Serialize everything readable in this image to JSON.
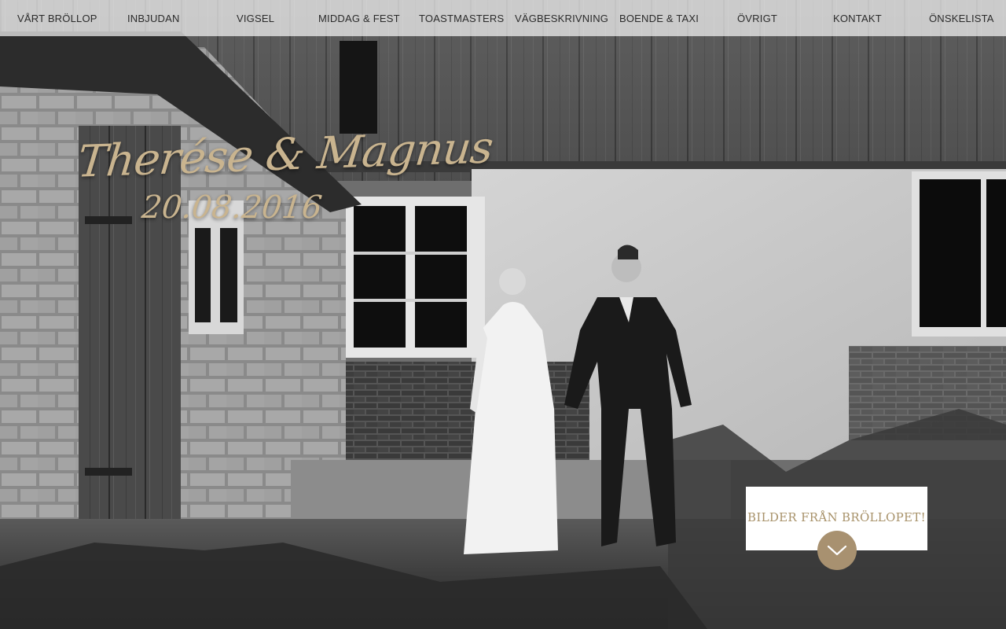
{
  "nav": {
    "items": [
      {
        "label": "VÅRT BRÖLLOP",
        "name": "nav-item-vart-brollop"
      },
      {
        "label": "INBJUDAN",
        "name": "nav-item-inbjudan"
      },
      {
        "label": "VIGSEL",
        "name": "nav-item-vigsel"
      },
      {
        "label": "MIDDAG & FEST",
        "name": "nav-item-middag-fest"
      },
      {
        "label": "TOASTMASTERS",
        "name": "nav-item-toastmasters"
      },
      {
        "label": "VÄGBESKRIVNING",
        "name": "nav-item-vagbeskrivning"
      },
      {
        "label": "BOENDE & TAXI",
        "name": "nav-item-boende-taxi"
      },
      {
        "label": "ÖVRIGT",
        "name": "nav-item-ovrigt"
      },
      {
        "label": "KONTAKT",
        "name": "nav-item-kontakt"
      },
      {
        "label": "ÖNSKELISTA",
        "name": "nav-item-onskelista"
      }
    ]
  },
  "hero": {
    "couple": "Therése & Magnus",
    "date": "20.08.2016"
  },
  "cta": {
    "label": "BILDER FRÅN BRÖLLOPET!",
    "arrow_icon": "chevron-down-icon"
  },
  "colors": {
    "accent_gold": "#c9b48f",
    "cta_text": "#a8926a",
    "arrow_circle": "#a89170"
  }
}
